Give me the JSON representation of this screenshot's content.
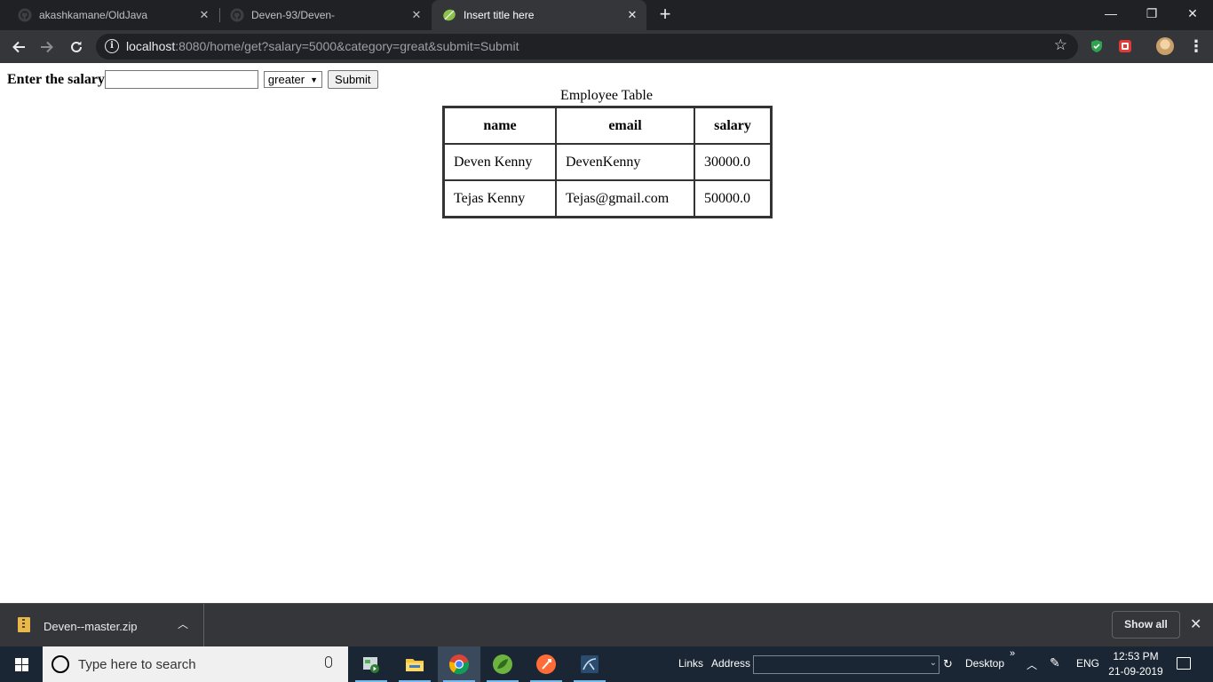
{
  "browser": {
    "tabs": [
      {
        "title": "akashkamane/OldJava",
        "icon": "github-icon"
      },
      {
        "title": "Deven-93/Deven-",
        "icon": "github-icon"
      },
      {
        "title": "Insert title here",
        "icon": "spring-leaf-icon",
        "active": true
      }
    ],
    "url": {
      "host": "localhost",
      "rest": ":8080/home/get?salary=5000&category=great&submit=Submit"
    },
    "window_controls": {
      "minimize": "—",
      "restore": "❐",
      "close": "✕"
    }
  },
  "page": {
    "form": {
      "label": "Enter the salary",
      "salary_value": "",
      "category_selected": "greater",
      "submit_label": "Submit"
    },
    "table": {
      "caption": "Employee Table",
      "headers": [
        "name",
        "email",
        "salary"
      ],
      "rows": [
        [
          "Deven Kenny",
          "DevenKenny",
          "30000.0"
        ],
        [
          "Tejas Kenny",
          "Tejas@gmail.com",
          "50000.0"
        ]
      ]
    }
  },
  "downloads": {
    "file_name": "Deven--master.zip",
    "show_all_label": "Show all"
  },
  "taskbar": {
    "search_placeholder": "Type here to search",
    "links_label": "Links",
    "address_label": "Address",
    "desktop_label": "Desktop",
    "language": "ENG",
    "time": "12:53 PM",
    "date": "21-09-2019"
  },
  "colors": {
    "titlebar": "#202124",
    "toolbar": "#35363a",
    "taskbar": "#1a2633",
    "adblock_shield": "#2ea44f",
    "extension_red": "#e53935"
  }
}
